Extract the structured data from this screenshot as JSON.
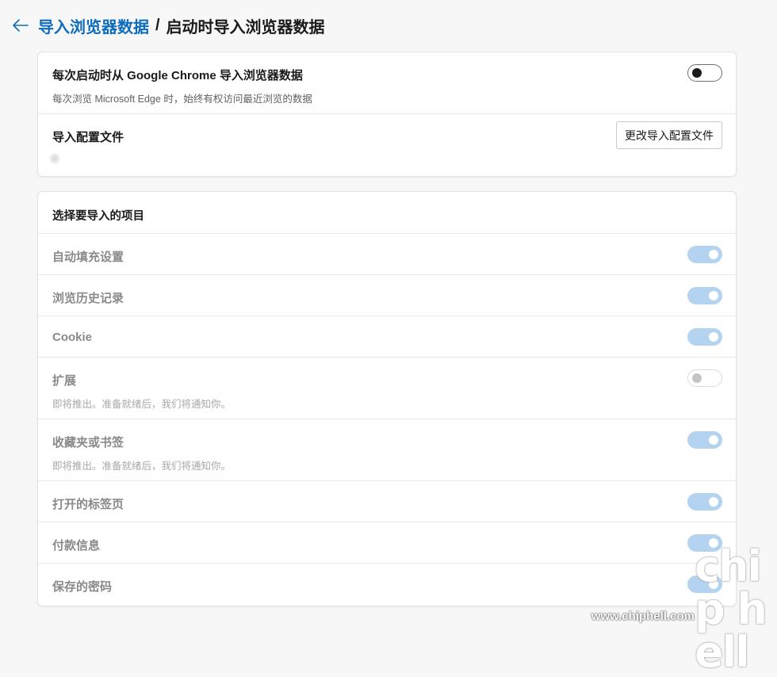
{
  "breadcrumb": {
    "parent": "导入浏览器数据",
    "separator": "/",
    "current": "启动时导入浏览器数据"
  },
  "startup_card": {
    "import_on_startup": {
      "title": "每次启动时从 Google Chrome 导入浏览器数据",
      "subtitle": "每次浏览 Microsoft Edge 时，始终有权访问最近浏览的数据",
      "toggle": "off"
    },
    "profile": {
      "title": "导入配置文件",
      "button_label": "更改导入配置文件"
    }
  },
  "items_card": {
    "header": "选择要导入的项目",
    "items": [
      {
        "label": "自动填充设置",
        "sub": "",
        "state": "on"
      },
      {
        "label": "浏览历史记录",
        "sub": "",
        "state": "on"
      },
      {
        "label": "Cookie",
        "sub": "",
        "state": "on"
      },
      {
        "label": "扩展",
        "sub": "即将推出。准备就绪后，我们将通知你。",
        "state": "off"
      },
      {
        "label": "收藏夹或书签",
        "sub": "即将推出。准备就绪后，我们将通知你。",
        "state": "on"
      },
      {
        "label": "打开的标签页",
        "sub": "",
        "state": "on"
      },
      {
        "label": "付款信息",
        "sub": "",
        "state": "on"
      },
      {
        "label": "保存的密码",
        "sub": "",
        "state": "on"
      }
    ]
  },
  "watermark": {
    "logo": "chip hell",
    "url": "www.chiphell.com"
  },
  "colors": {
    "accent": "#0f6cbd",
    "toggle_on_disabled": "#b3d3f0",
    "background": "#f7f7f7"
  }
}
